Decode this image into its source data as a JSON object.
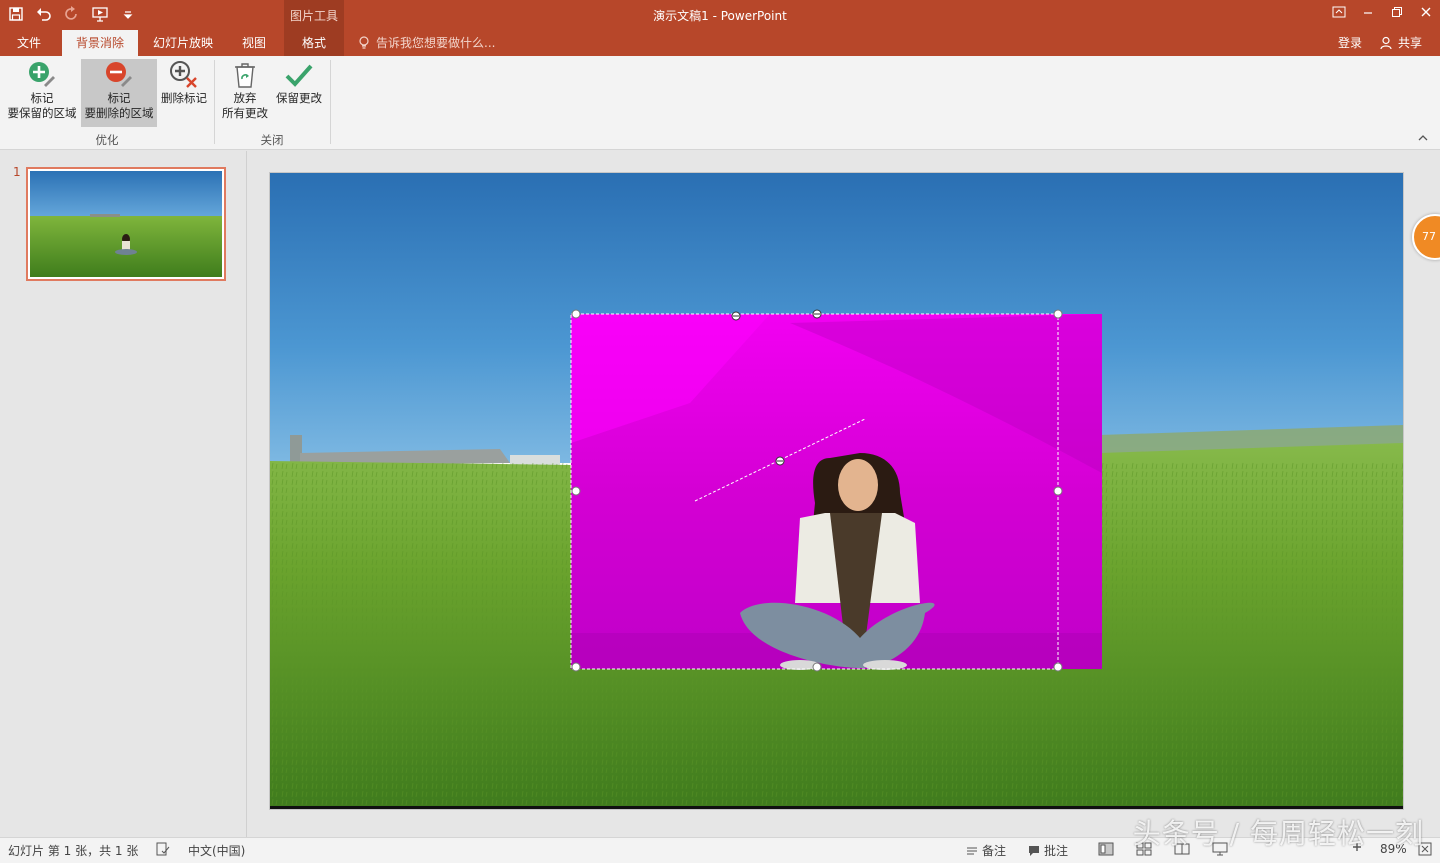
{
  "window": {
    "title": "演示文稿1 - PowerPoint",
    "context_group": "图片工具",
    "controls": [
      "ribbon-display-icon",
      "minimize-icon",
      "restore-icon",
      "close-icon"
    ]
  },
  "quick_access": {
    "items": [
      "save-icon",
      "undo-icon",
      "redo-icon",
      "start-from-beginning-icon",
      "customize-qat-icon"
    ]
  },
  "tabs": [
    {
      "label": "文件"
    },
    {
      "label": "背景消除",
      "active": true
    },
    {
      "label": "幻灯片放映"
    },
    {
      "label": "视图"
    },
    {
      "label": "格式"
    }
  ],
  "tellme": {
    "placeholder": "告诉我您想要做什么..."
  },
  "account": {
    "login": "登录",
    "share": "共享"
  },
  "ribbon": {
    "buttons": [
      {
        "line1": "标记",
        "line2": "要保留的区域"
      },
      {
        "line1": "标记",
        "line2": "要删除的区域",
        "pressed": true
      },
      {
        "line1": "删除标记",
        "line2": ""
      },
      {
        "line1": "放弃",
        "line2": "所有更改"
      },
      {
        "line1": "保留更改",
        "line2": ""
      }
    ],
    "groups": [
      {
        "label": "优化"
      },
      {
        "label": "关闭"
      }
    ]
  },
  "thumbnails": {
    "slides": [
      {
        "number": "1"
      }
    ]
  },
  "overlay": {
    "bubble_text": "77"
  },
  "statusbar": {
    "slide_info": "幻灯片 第 1 张，共 1 张",
    "language": "中文(中国)",
    "notes": "备注",
    "comments": "批注",
    "zoom": "89%"
  },
  "watermark": "头条号 / 每周轻松一刻",
  "colors": {
    "accent": "#b7472a",
    "removal_overlay": "#e000e0",
    "sky": "#3d86c4",
    "grass": "#5c9a26"
  }
}
